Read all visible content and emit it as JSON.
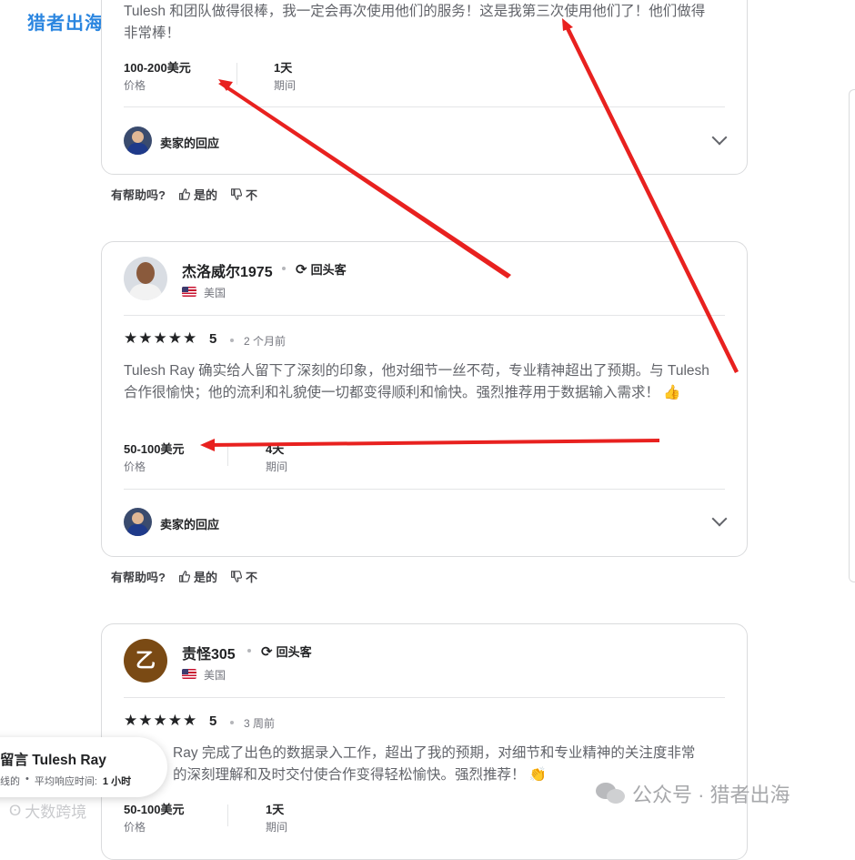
{
  "watermark": {
    "top_left": "猎者出海",
    "bottom_left": "大数跨境",
    "bottom_right": "公众号 · 猎者出海"
  },
  "review1": {
    "text": "Tulesh 和团队做得很棒，我一定会再次使用他们的服务！这是我第三次使用他们了！他们做得非常棒！",
    "price_value": "100-200美元",
    "price_label": "价格",
    "duration_value": "1天",
    "duration_label": "期间",
    "seller_response": "卖家的回应"
  },
  "helpful1": {
    "question": "有帮助吗?",
    "yes": "是的",
    "no": "不"
  },
  "review2": {
    "name": "杰洛威尔1975",
    "repeat_label": "回头客",
    "country": "美国",
    "stars": "★★★★★",
    "rating": "5",
    "time_ago": "2 个月前",
    "text": "Tulesh Ray 确实给人留下了深刻的印象，他对细节一丝不苟，专业精神超出了预期。与 Tulesh 合作很愉快；他的流利和礼貌使一切都变得顺利和愉快。强烈推荐用于数据输入需求！ 👍",
    "price_value": "50-100美元",
    "price_label": "价格",
    "duration_value": "4天",
    "duration_label": "期间",
    "seller_response": "卖家的回应"
  },
  "helpful2": {
    "question": "有帮助吗?",
    "yes": "是的",
    "no": "不"
  },
  "review3": {
    "name": "责怪305",
    "avatar_letter": "乙",
    "repeat_label": "回头客",
    "country": "美国",
    "stars": "★★★★★",
    "rating": "5",
    "time_ago": "3 周前",
    "text_line1": "Ray 完成了出色的数据录入工作，超出了我的预期，对细节和专业精神的关注度非常",
    "text_line2": "的深刻理解和及时交付使合作变得轻松愉快。强烈推荐！ 👏",
    "price_value": "50-100美元",
    "price_label": "价格",
    "duration_value": "1天",
    "duration_label": "期间"
  },
  "contact_popup": {
    "title": "留言 Tulesh Ray",
    "status": "线的",
    "response_label": "平均响应时间:",
    "response_value": "1 小时"
  },
  "colors": {
    "arrow": "#e8211f",
    "avatar3": "#7a4a14"
  },
  "icons": [
    "repeat-icon",
    "thumbs-up-icon",
    "thumbs-down-icon",
    "chevron-down-icon",
    "us-flag-icon"
  ]
}
